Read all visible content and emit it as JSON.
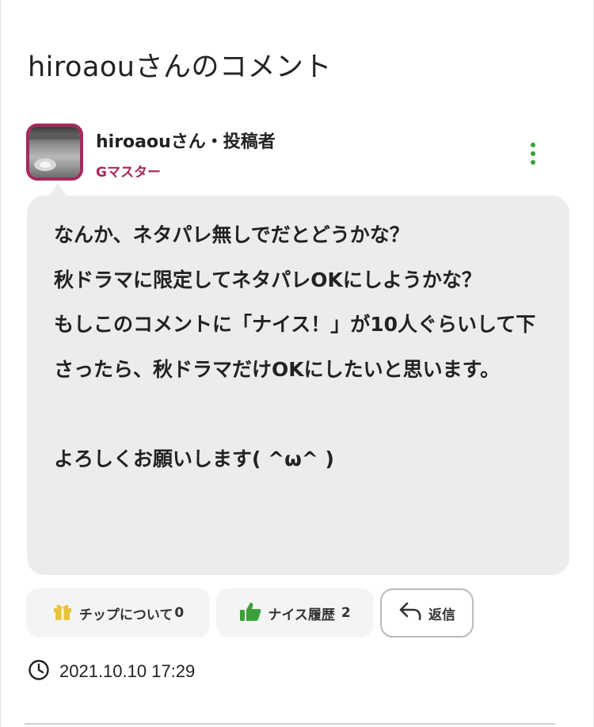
{
  "header": {
    "title": "hiroaouさんのコメント"
  },
  "comment": {
    "author": "hiroaouさん・投稿者",
    "rank": "Gマスター",
    "body": "なんか、ネタパレ無しでだとどうかな？\n秋ドラマに限定してネタパレOKにしようかな？\nもしこのコメントに「ナイス！」が10人ぐらいして下さったら、秋ドラマだけOKにしたいと思います。\n\nよろしくお願いします( ^ω^ )",
    "timestamp": "2021.10.10 17:29"
  },
  "actions": {
    "tip_label": "チップについて",
    "tip_count": "0",
    "nice_label": "ナイス履歴",
    "nice_count": "2",
    "reply_label": "返信"
  },
  "icons": {
    "menu": "more-vertical-icon",
    "tip": "gift-icon",
    "nice": "thumbs-up-icon",
    "reply": "reply-arrow-icon",
    "time": "clock-icon"
  },
  "colors": {
    "rank": "#a8285c",
    "accent_green": "#3aa13a",
    "gift_yellow": "#e8c33a",
    "bubble_bg": "#eaedec"
  }
}
